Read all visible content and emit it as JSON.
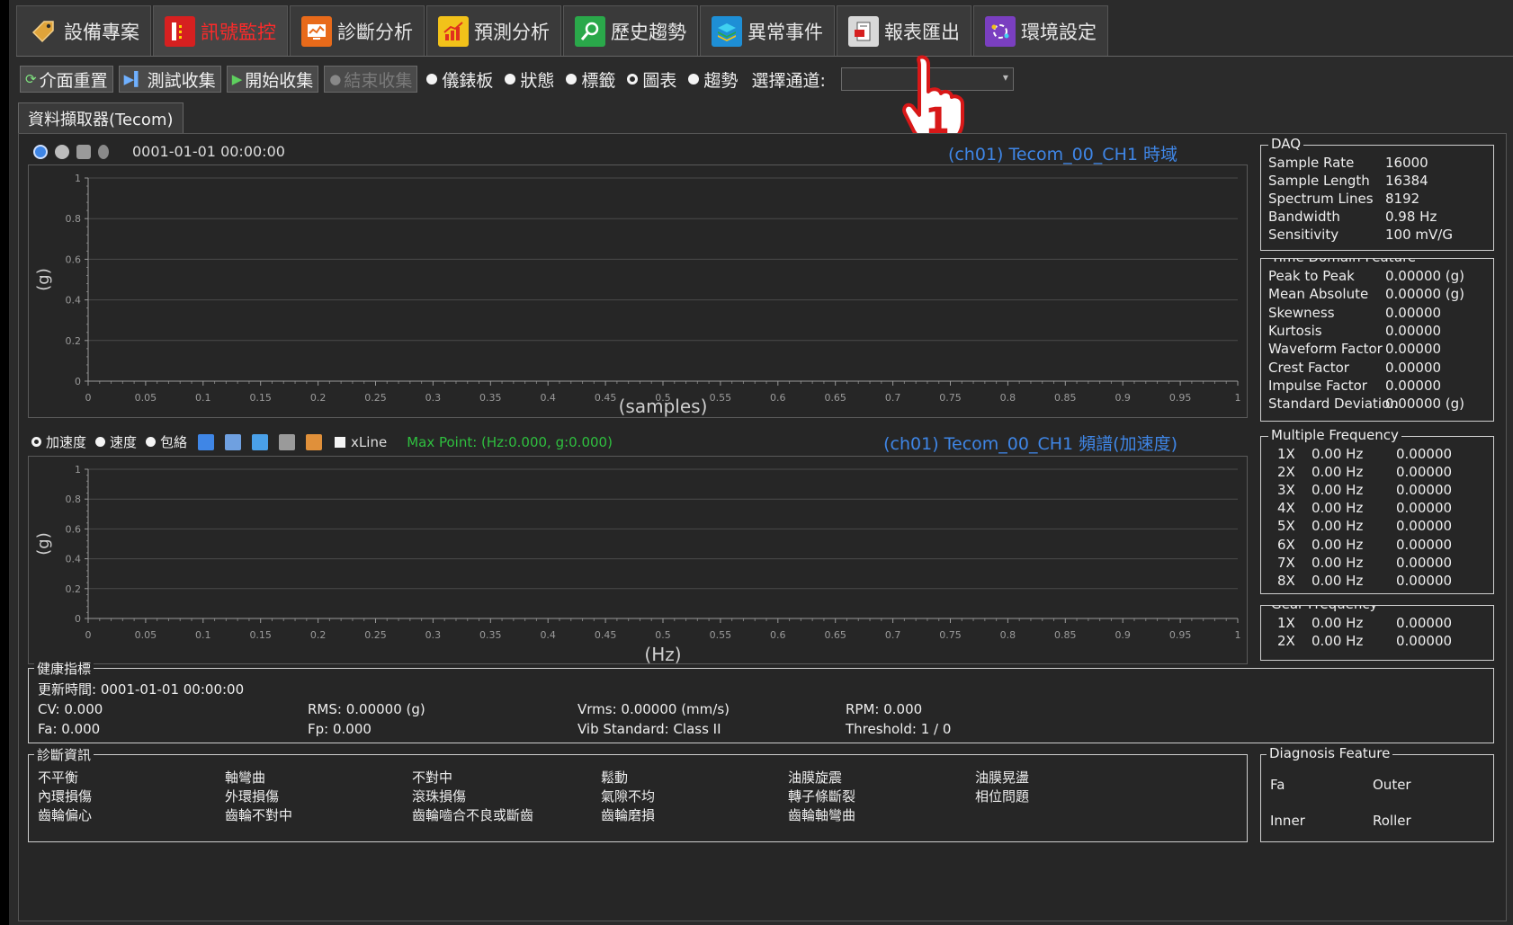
{
  "module_tabs": [
    {
      "label": "設備專案",
      "icon": "tag-icon",
      "active": false
    },
    {
      "label": "訊號監控",
      "icon": "signal-monitor-icon",
      "active": true
    },
    {
      "label": "診斷分析",
      "icon": "diagnosis-icon",
      "active": false
    },
    {
      "label": "預測分析",
      "icon": "prediction-chart-icon",
      "active": false
    },
    {
      "label": "歷史趨勢",
      "icon": "history-search-icon",
      "active": false
    },
    {
      "label": "異常事件",
      "icon": "layers-icon",
      "active": false
    },
    {
      "label": "報表匯出",
      "icon": "report-export-icon",
      "active": false
    },
    {
      "label": "環境設定",
      "icon": "settings-network-icon",
      "active": false
    }
  ],
  "toolbar": {
    "reset": "介面重置",
    "test_collect": "測試收集",
    "start_collect": "開始收集",
    "stop_collect": "結束收集",
    "views": [
      {
        "label": "儀錶板",
        "checked": false
      },
      {
        "label": "狀態",
        "checked": false
      },
      {
        "label": "標籤",
        "checked": false
      },
      {
        "label": "圖表",
        "checked": true
      },
      {
        "label": "趨勢",
        "checked": false
      }
    ],
    "channel_label": "選擇通道:",
    "channel_value": ""
  },
  "cursor_marker": "1",
  "sub_tab": "資料擷取器(Tecom)",
  "time_chart": {
    "timestamp": "0001-01-01 00:00:00",
    "title": "(ch01) Tecom_00_CH1 時域",
    "ylabel": "(g)",
    "xlabel": "(samples)"
  },
  "freq_chart": {
    "options": [
      {
        "label": "加速度",
        "checked": true
      },
      {
        "label": "速度",
        "checked": false
      },
      {
        "label": "包絡",
        "checked": false
      }
    ],
    "xline_label": "xLine",
    "max_point": "Max Point: (Hz:0.000, g:0.000)",
    "title": "(ch01) Tecom_00_CH1 頻譜(加速度)",
    "ylabel": "(g)",
    "xlabel": "(Hz)"
  },
  "chart_data": [
    {
      "type": "line",
      "title": "(ch01) Tecom_00_CH1 時域",
      "xlabel": "(samples)",
      "ylabel": "(g)",
      "xlim": [
        0,
        1
      ],
      "ylim": [
        0,
        1
      ],
      "x_ticks": [
        "0",
        "0.05",
        "0.1",
        "0.15",
        "0.2",
        "0.25",
        "0.3",
        "0.35",
        "0.4",
        "0.45",
        "0.5",
        "0.55",
        "0.6",
        "0.65",
        "0.7",
        "0.75",
        "0.8",
        "0.85",
        "0.9",
        "0.95",
        "1"
      ],
      "y_ticks": [
        "0",
        "0.2",
        "0.4",
        "0.6",
        "0.8",
        "1"
      ],
      "grid": true,
      "series": []
    },
    {
      "type": "line",
      "title": "(ch01) Tecom_00_CH1 頻譜(加速度)",
      "xlabel": "(Hz)",
      "ylabel": "(g)",
      "xlim": [
        0,
        1
      ],
      "ylim": [
        0,
        1
      ],
      "x_ticks": [
        "0",
        "0.05",
        "0.1",
        "0.15",
        "0.2",
        "0.25",
        "0.3",
        "0.35",
        "0.4",
        "0.45",
        "0.5",
        "0.55",
        "0.6",
        "0.65",
        "0.7",
        "0.75",
        "0.8",
        "0.85",
        "0.9",
        "0.95",
        "1"
      ],
      "y_ticks": [
        "0",
        "0.2",
        "0.4",
        "0.6",
        "0.8",
        "1"
      ],
      "grid": true,
      "series": []
    }
  ],
  "daq": {
    "title": "DAQ",
    "rows": [
      {
        "k": "Sample Rate",
        "v": "16000"
      },
      {
        "k": "Sample Length",
        "v": "16384"
      },
      {
        "k": "Spectrum Lines",
        "v": "8192"
      },
      {
        "k": "Bandwidth",
        "v": "0.98 Hz"
      },
      {
        "k": "Sensitivity",
        "v": "100 mV/G"
      }
    ]
  },
  "time_feature": {
    "title": "Time Domain Feature",
    "rows": [
      {
        "k": "Peak to Peak",
        "v": "0.00000 (g)"
      },
      {
        "k": "Mean Absolute",
        "v": "0.00000 (g)"
      },
      {
        "k": "Skewness",
        "v": "0.00000"
      },
      {
        "k": "Kurtosis",
        "v": "0.00000"
      },
      {
        "k": "Waveform Factor",
        "v": "0.00000"
      },
      {
        "k": "Crest Factor",
        "v": "0.00000"
      },
      {
        "k": "Impulse Factor",
        "v": "0.00000"
      },
      {
        "k": "Standard Deviation",
        "v": "0.00000 (g)"
      }
    ]
  },
  "multi_freq": {
    "title": "Multiple Frequency",
    "rows": [
      {
        "n": "1X",
        "hz": "0.00 Hz",
        "v": "0.00000"
      },
      {
        "n": "2X",
        "hz": "0.00 Hz",
        "v": "0.00000"
      },
      {
        "n": "3X",
        "hz": "0.00 Hz",
        "v": "0.00000"
      },
      {
        "n": "4X",
        "hz": "0.00 Hz",
        "v": "0.00000"
      },
      {
        "n": "5X",
        "hz": "0.00 Hz",
        "v": "0.00000"
      },
      {
        "n": "6X",
        "hz": "0.00 Hz",
        "v": "0.00000"
      },
      {
        "n": "7X",
        "hz": "0.00 Hz",
        "v": "0.00000"
      },
      {
        "n": "8X",
        "hz": "0.00 Hz",
        "v": "0.00000"
      }
    ]
  },
  "gear_freq": {
    "title": "Gear Frequency",
    "rows": [
      {
        "n": "1X",
        "hz": "0.00 Hz",
        "v": "0.00000"
      },
      {
        "n": "2X",
        "hz": "0.00 Hz",
        "v": "0.00000"
      }
    ]
  },
  "health": {
    "title": "健康指標",
    "update_time": "更新時間: 0001-01-01 00:00:00",
    "items": [
      "CV: 0.000",
      "RMS: 0.00000 (g)",
      "Vrms: 0.00000 (mm/s)",
      "RPM: 0.000",
      "Fa: 0.000",
      "Fp: 0.000",
      "Vib Standard: Class II",
      "Threshold: 1 / 0"
    ]
  },
  "diagnosis": {
    "title": "診斷資訊",
    "items": [
      "不平衡",
      "軸彎曲",
      "不對中",
      "鬆動",
      "油膜旋震",
      "油膜晃盪",
      "內環損傷",
      "外環損傷",
      "滾珠損傷",
      "氣隙不均",
      "轉子條斷裂",
      "相位問題",
      "齒輪偏心",
      "齒輪不對中",
      "齒輪嚙合不良或斷齒",
      "齒輪磨損",
      "齒輪軸彎曲"
    ]
  },
  "diag_feature": {
    "title": "Diagnosis Feature",
    "items": [
      "Fa",
      "Outer",
      "Inner",
      "Roller"
    ]
  },
  "colors": {
    "active_tab_text": "#ff2a2a",
    "chart_title_blue": "#3f86e6",
    "max_point_green": "#2fbf3f",
    "background": "#2b2b2b"
  }
}
